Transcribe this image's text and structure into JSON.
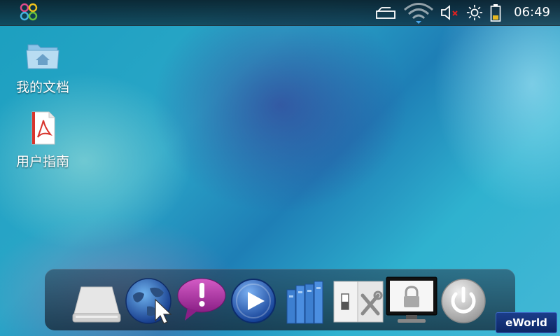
{
  "status_bar": {
    "time": "06:49",
    "icons": [
      "launcher-icon",
      "usb-storage-icon",
      "wifi-icon",
      "volume-muted-icon",
      "brightness-icon",
      "battery-icon"
    ]
  },
  "desktop": {
    "items": [
      {
        "label": "我的文档",
        "icon": "home-folder-icon"
      },
      {
        "label": "用户指南",
        "icon": "pdf-document-icon"
      }
    ]
  },
  "dock": {
    "items": [
      {
        "icon": "drive-icon"
      },
      {
        "icon": "globe-browser-icon"
      },
      {
        "icon": "message-alert-icon"
      },
      {
        "icon": "media-player-icon"
      },
      {
        "icon": "books-icon"
      },
      {
        "icon": "settings-tools-icon"
      },
      {
        "icon": "lock-screen-icon"
      },
      {
        "icon": "power-icon"
      }
    ]
  },
  "brand": {
    "label": "eWorld"
  },
  "colors": {
    "accent": "#1e9fc4",
    "badge": "#0d2766",
    "alert": "#b0309a"
  }
}
